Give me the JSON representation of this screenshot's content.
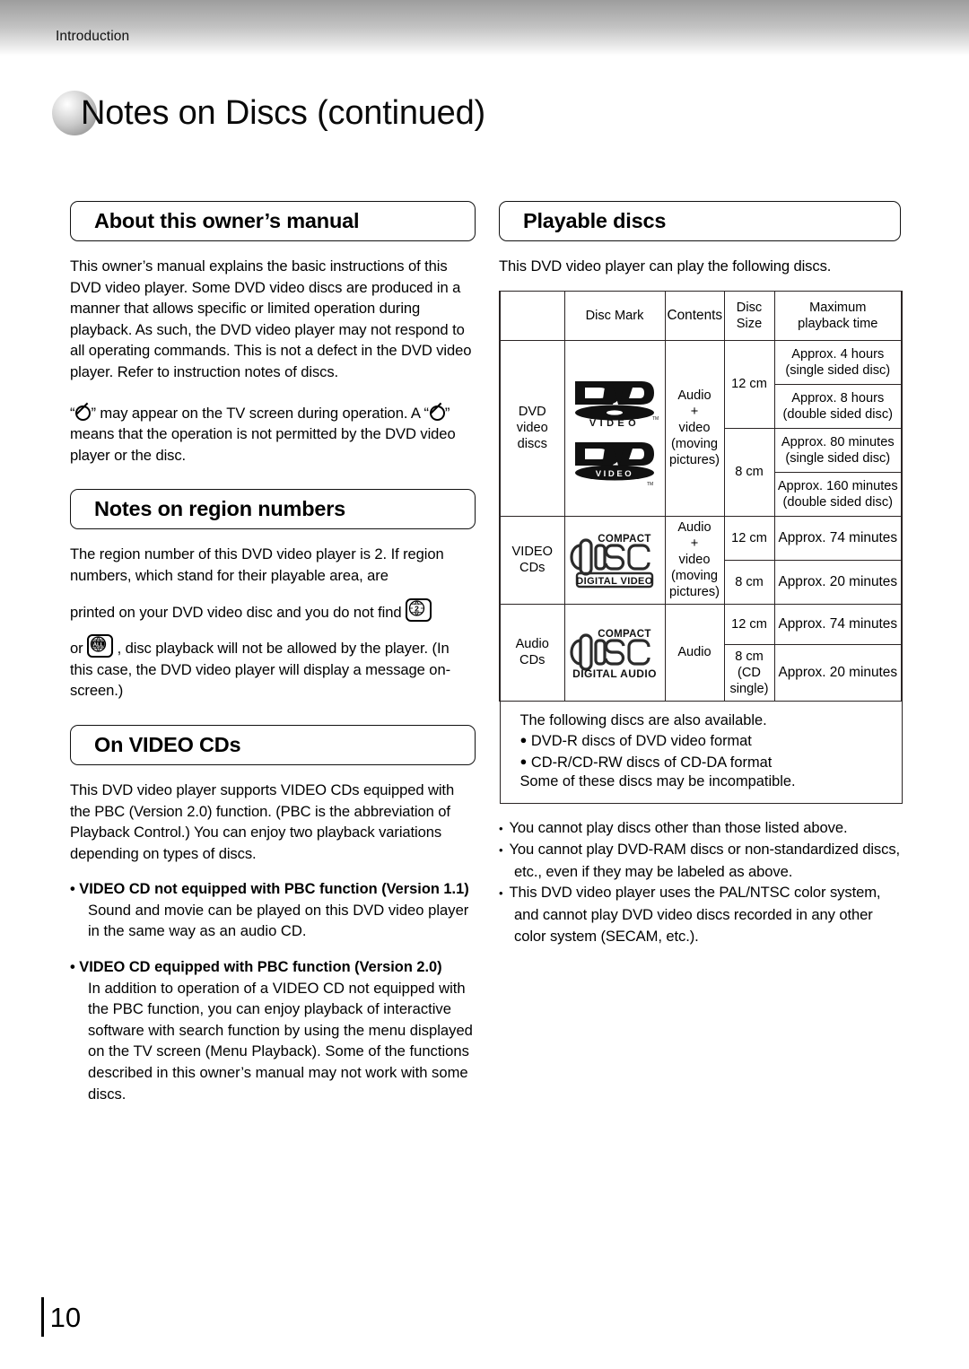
{
  "header": {
    "running_title": "Introduction"
  },
  "page_title": "Notes on Discs (continued)",
  "page_number": "10",
  "left_column": {
    "section1": {
      "heading": "About this owner’s manual",
      "paragraph1": "This owner’s manual explains the basic instructions of this DVD video player. Some DVD video discs are produced in a manner that allows specific or limited operation during playback. As such, the DVD video player may not respond to all operating commands. This is not a defect in the DVD video player. Refer to instruction notes of discs.",
      "paragraph2_part1": "“",
      "paragraph2_part2": "” may appear on the TV screen during operation. A “",
      "paragraph2_part3": "” means that the operation is not permitted by the DVD video player or the disc."
    },
    "section2": {
      "heading": "Notes on region numbers",
      "text_a": "The region number of this DVD video player is 2. If region numbers, which stand for their playable area, are",
      "text_b": "printed on your DVD video disc and you do not find",
      "text_c": "or",
      "text_d": ", disc playback will not be allowed by the player. (In this case, the DVD video player will display a message on-screen.)",
      "icon_region2_label": "2",
      "icon_regionall_label": "ALL"
    },
    "section3": {
      "heading": "On VIDEO CDs",
      "paragraph1": "This DVD video player supports VIDEO CDs equipped with the PBC (Version 2.0) function. (PBC is the abbreviation of Playback Control.) You can enjoy two playback variations depending on types of discs.",
      "bullets": [
        {
          "title": "• VIDEO CD not equipped with PBC function (Version 1.1)",
          "body": "Sound and movie can be played on this DVD video player in the same way as an audio CD."
        },
        {
          "title": "• VIDEO CD equipped with PBC function (Version 2.0)",
          "body": "In addition to operation of a VIDEO CD not equipped with the PBC function, you can enjoy playback of interactive software with search function by using the menu displayed on the TV screen (Menu Playback). Some of the functions described in this owner’s manual may not work with some discs."
        }
      ]
    }
  },
  "right_column": {
    "section1": {
      "heading": "Playable discs",
      "intro": "This DVD video player can play the following discs."
    },
    "table": {
      "headers": {
        "blank": "",
        "disc_mark": "Disc Mark",
        "contents": "Contents",
        "disc_size": "Disc\nSize",
        "disc_size_line1": "Disc",
        "disc_size_line2": "Size",
        "max_time_line1": "Maximum",
        "max_time_line2": "playback time"
      },
      "rows": [
        {
          "name_line1": "DVD",
          "name_line2": "video",
          "name_line3": "discs",
          "logo": "dvd-video-logo",
          "contents_line1": "Audio",
          "contents_line2": "+",
          "contents_line3": "video",
          "contents_line4": "(moving",
          "contents_line5": "pictures)",
          "sizes": [
            {
              "size": "12 cm",
              "times": [
                {
                  "line1": "Approx. 4 hours",
                  "line2": "(single sided disc)"
                },
                {
                  "line1": "Approx. 8 hours",
                  "line2": "(double sided disc)"
                }
              ]
            },
            {
              "size": "8 cm",
              "times": [
                {
                  "line1": "Approx. 80 minutes",
                  "line2": "(single sided disc)"
                },
                {
                  "line1": "Approx. 160 minutes",
                  "line2": "(double sided disc)"
                }
              ]
            }
          ]
        },
        {
          "name_line1": "VIDEO",
          "name_line2": "CDs",
          "logo": "compact-disc-digital-video-logo",
          "contents_line1": "Audio",
          "contents_line2": "+",
          "contents_line3": "video",
          "contents_line4": "(moving",
          "contents_line5": "pictures)",
          "sizes": [
            {
              "size": "12 cm",
              "times": [
                {
                  "line1": "Approx. 74 minutes",
                  "line2": ""
                }
              ]
            },
            {
              "size": "8 cm",
              "times": [
                {
                  "line1": "Approx. 20 minutes",
                  "line2": ""
                }
              ]
            }
          ]
        },
        {
          "name_line1": "Audio",
          "name_line2": "CDs",
          "logo": "compact-disc-digital-audio-logo",
          "contents_line1": "Audio",
          "sizes": [
            {
              "size": "12 cm",
              "times": [
                {
                  "line1": "Approx. 74 minutes",
                  "line2": ""
                }
              ]
            },
            {
              "size_line1": "8 cm",
              "size_line2": "(CD",
              "size_line3": "single)",
              "times": [
                {
                  "line1": "Approx. 20 minutes",
                  "line2": ""
                }
              ]
            }
          ]
        }
      ],
      "footer_note": {
        "line1": "The following discs are also available.",
        "line2": "DVD-R discs of DVD video format",
        "line3": "CD-R/CD-RW discs of CD-DA format",
        "line4": "Some of these discs may be incompatible."
      }
    },
    "tail_bullets": [
      "You cannot play discs other than those listed above.",
      "You cannot play DVD-RAM discs or non-standardized discs, etc., even if they may be labeled as above.",
      "This DVD video player uses the PAL/NTSC color system, and cannot play DVD video discs recorded in any other color system (SECAM, etc.)."
    ]
  },
  "logos": {
    "dvd_video_top": "DVD",
    "dvd_video_top_sub": "V I D E O",
    "dvd_video_bottom": "DVD",
    "dvd_video_bottom_sub": "VIDEO",
    "cd_compact": "COMPACT",
    "cd_disc": "disc",
    "cd_digital_video": "DIGITAL VIDEO",
    "cd_digital_audio": "DIGITAL AUDIO",
    "tm": "TM"
  },
  "colors": {
    "ink": "#000000",
    "rule": "#2a2424",
    "header_band_top": "#9d9d9d",
    "header_band_bottom": "#ffffff"
  }
}
